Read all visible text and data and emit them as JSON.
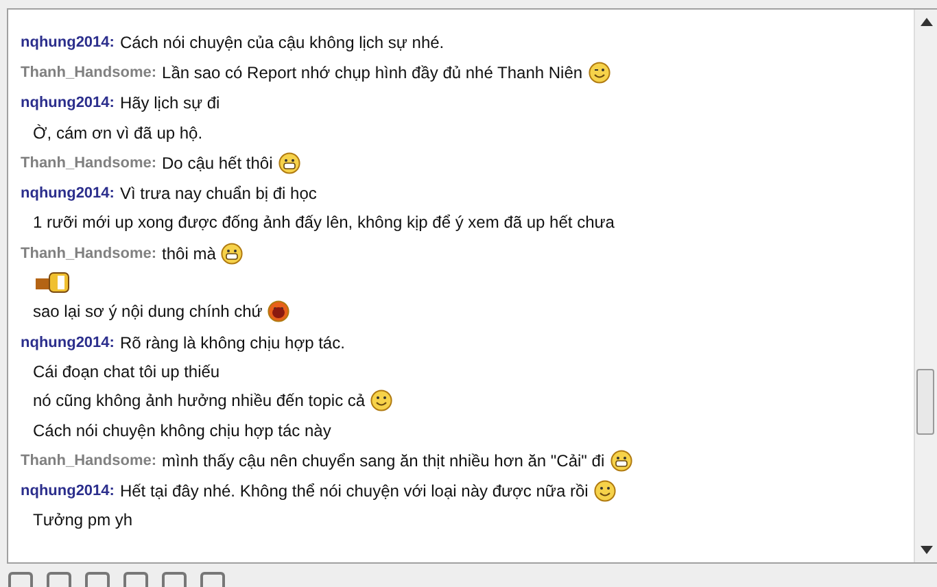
{
  "messages": [
    {
      "sender": "nqhung2014:",
      "color": "#2b2e8c",
      "text": "Cách nói chuyện của cậu không lịch sự nhé."
    },
    {
      "sender": "Thanh_Handsome:",
      "color": "#808080",
      "text": "Lần sao có Report nhớ chụp hình đầy đủ nhé Thanh Niên",
      "emoticon": {
        "kind": "wink"
      }
    },
    {
      "sender": "nqhung2014:",
      "color": "#2b2e8c",
      "text": "Hãy lịch sự đi"
    },
    {
      "text": "Ờ, cám ơn vì đã up hộ."
    },
    {
      "sender": "Thanh_Handsome:",
      "color": "#808080",
      "text": "Do cậu hết thôi",
      "emoticon": {
        "kind": "grin"
      }
    },
    {
      "sender": "nqhung2014:",
      "color": "#2b2e8c",
      "text": "Vì trưa nay chuẩn bị đi học"
    },
    {
      "text": "1 rưỡi mới up xong được đống ảnh đấy lên, không kịp để ý xem đã up hết chưa"
    },
    {
      "sender": "Thanh_Handsome:",
      "color": "#808080",
      "text": "thôi mà",
      "emoticon": {
        "kind": "grin"
      }
    },
    {
      "emoticon": {
        "kind": "figure"
      }
    },
    {
      "text": "sao lại sơ ý nội dung chính chứ",
      "emoticon": {
        "kind": "laugh"
      }
    },
    {
      "sender": "nqhung2014:",
      "color": "#2b2e8c",
      "text": "Rõ ràng là không chịu hợp tác."
    },
    {
      "text": "Cái đoạn chat tôi up thiếu"
    },
    {
      "text": "nó cũng không ảnh hưởng nhiều đến topic cả",
      "emoticon": {
        "kind": "smile"
      }
    },
    {
      "text": "Cách nói chuyện không chịu hợp tác này"
    },
    {
      "sender": "Thanh_Handsome:",
      "color": "#808080",
      "text": "mình thấy cậu nên chuyển sang ăn thịt nhiều hơn ăn \"Cải\" đi",
      "emoticon": {
        "kind": "grin"
      }
    },
    {
      "sender": "nqhung2014:",
      "color": "#2b2e8c",
      "text": "Hết tại đây nhé. Không thể nói chuyện với loại này được nữa rồi",
      "emoticon": {
        "kind": "smile"
      }
    },
    {
      "text": "Tưởng pm yh"
    }
  ]
}
